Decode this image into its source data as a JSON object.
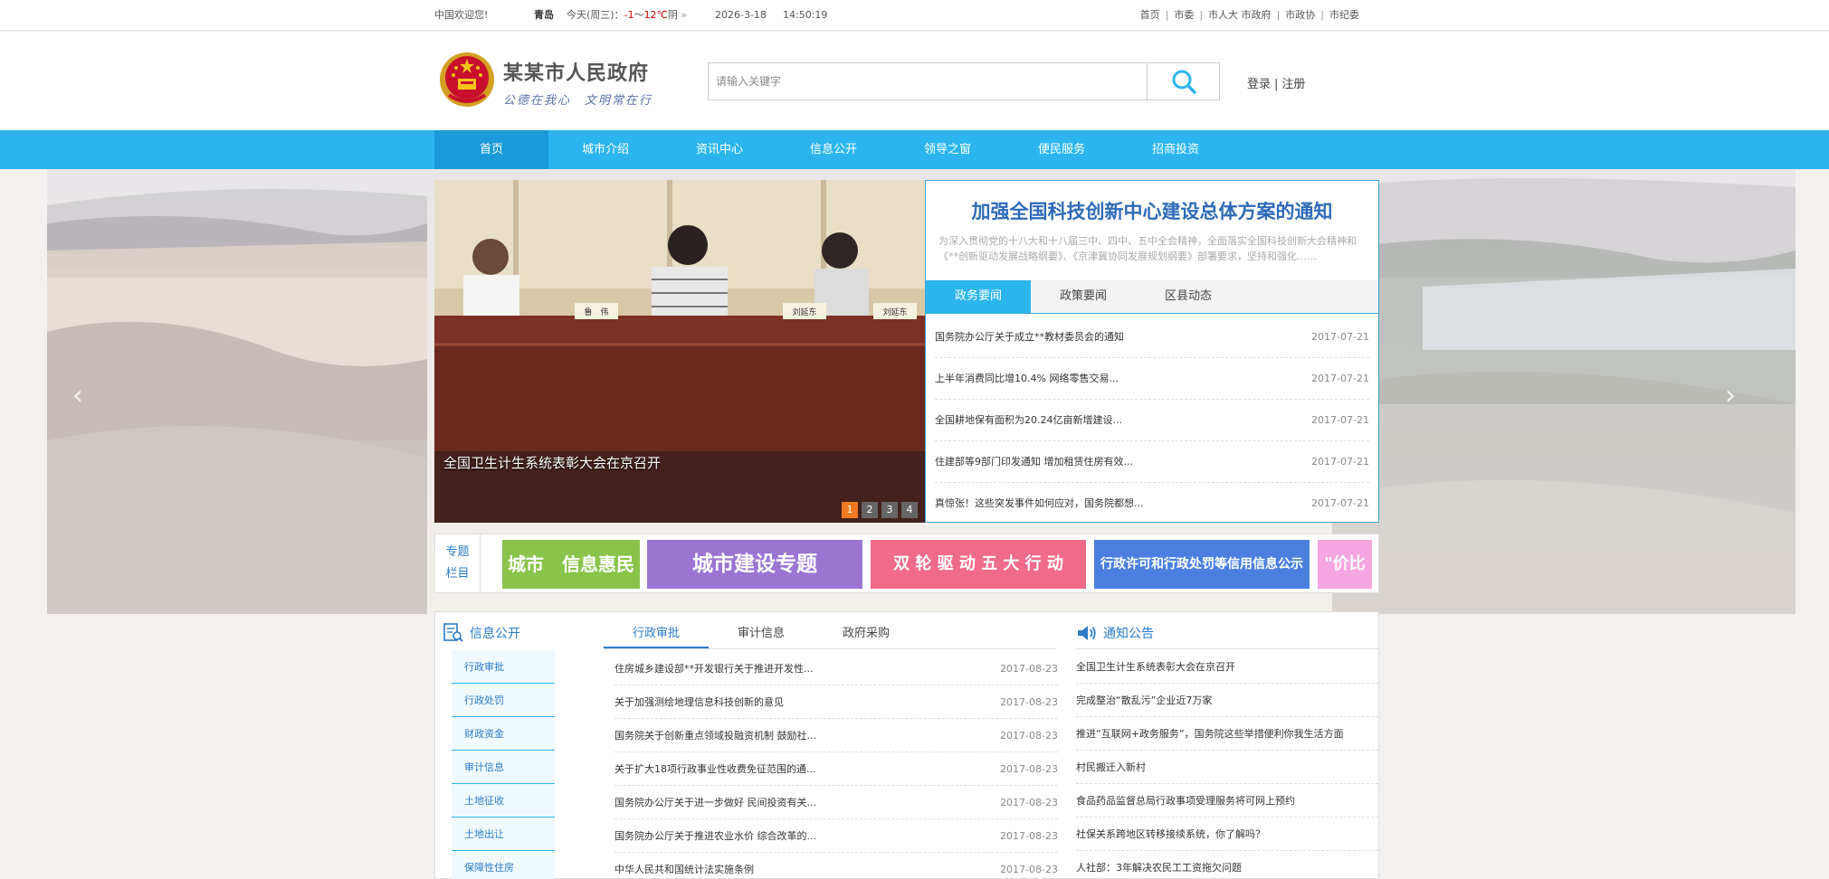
{
  "topbar": {
    "welcome": "中国欢迎您!",
    "city": "青岛",
    "weather_day": "今天(周三)：",
    "temp_low": "-1",
    "temp_sep": "～",
    "temp_high": "12℃",
    "condition": "阴",
    "date": "2026-3-18",
    "time": "14:50:19",
    "links": [
      "首页",
      "市委",
      "市人大 市政府",
      "市政协",
      "市纪委"
    ]
  },
  "header": {
    "title": "某某市人民政府",
    "slogan": "公德在我心　文明常在行",
    "search_placeholder": "请输入关键字",
    "login": "登录",
    "register": "注册",
    "auth_sep": "|"
  },
  "nav": {
    "items": [
      "首页",
      "城市介绍",
      "资讯中心",
      "信息公开",
      "领导之窗",
      "便民服务",
      "招商投资"
    ]
  },
  "slider": {
    "caption": "全国卫生计生系统表彰大会在京召开",
    "dots": [
      "1",
      "2",
      "3",
      "4"
    ],
    "nameplates": [
      "鲁　伟",
      "刘延东",
      "刘延东"
    ]
  },
  "news": {
    "headline": "加强全国科技创新中心建设总体方案的通知",
    "summary": "为深入贯彻党的十八大和十八届三中、四中、五中全会精神，全面落实全国科技创新大会精神和《**创新驱动发展战略纲要》、《京津冀协同发展规划纲要》部署要求，坚持和强化……",
    "tabs": [
      "政务要闻",
      "政策要闻",
      "区县动态"
    ],
    "items": [
      {
        "title": "国务院办公厅关于成立**教材委员会的通知",
        "date": "2017-07-21"
      },
      {
        "title": "上半年消费同比增10.4% 网络零售交易...",
        "date": "2017-07-21"
      },
      {
        "title": "全国耕地保有面积为20.24亿亩新增建设...",
        "date": "2017-07-21"
      },
      {
        "title": "住建部等9部门印发通知 增加租赁住房有效...",
        "date": "2017-07-21"
      },
      {
        "title": "真惊张！这些突发事件如何应对，国务院都想...",
        "date": "2017-07-21"
      }
    ]
  },
  "topics": {
    "label_line1": "专题",
    "label_line2": "栏目",
    "banners": [
      {
        "text": "城市　信息惠民",
        "color": "#8ac34a"
      },
      {
        "text": "城市建设专题",
        "color": "#9b74d2"
      },
      {
        "text": "双 轮 驱 动 五 大 行 动",
        "color": "#f06b8a"
      },
      {
        "text": "行政许可和行政处罚等信用信息公示",
        "color": "#4a7fe0"
      },
      {
        "text": "\"价比",
        "color": "#f5a5e0"
      }
    ]
  },
  "info": {
    "title": "信息公开",
    "side_items": [
      "行政审批",
      "行政处罚",
      "财政资金",
      "审计信息",
      "土地征收",
      "土地出让",
      "保障性住房"
    ],
    "tabs": [
      "行政审批",
      "审计信息",
      "政府采购"
    ],
    "items": [
      {
        "title": "住房城乡建设部**开发银行关于推进开发性...",
        "date": "2017-08-23"
      },
      {
        "title": "关于加强测绘地理信息科技创新的意见",
        "date": "2017-08-23"
      },
      {
        "title": "国务院关于创新重点领域投融资机制 鼓励社...",
        "date": "2017-08-23"
      },
      {
        "title": "关于扩大18项行政事业性收费免征范围的通...",
        "date": "2017-08-23"
      },
      {
        "title": "国务院办公厅关于进一步做好 民间投资有关...",
        "date": "2017-08-23"
      },
      {
        "title": "国务院办公厅关于推进农业水价 综合改革的...",
        "date": "2017-08-23"
      },
      {
        "title": "中华人民共和国统计法实施条例",
        "date": "2017-08-23"
      }
    ]
  },
  "notice": {
    "title": "通知公告",
    "items": [
      "全国卫生计生系统表彰大会在京召开",
      "完成整治“散乱污”企业近7万家",
      "推进“互联网+政务服务”，国务院这些举措便利你我生活方面",
      "村民搬迁入新村",
      "食品药品监督总局行政事项受理服务将可网上预约",
      "社保关系跨地区转移接续系统，你了解吗？",
      "人社部：3年解决农民工工资拖欠问题"
    ]
  }
}
